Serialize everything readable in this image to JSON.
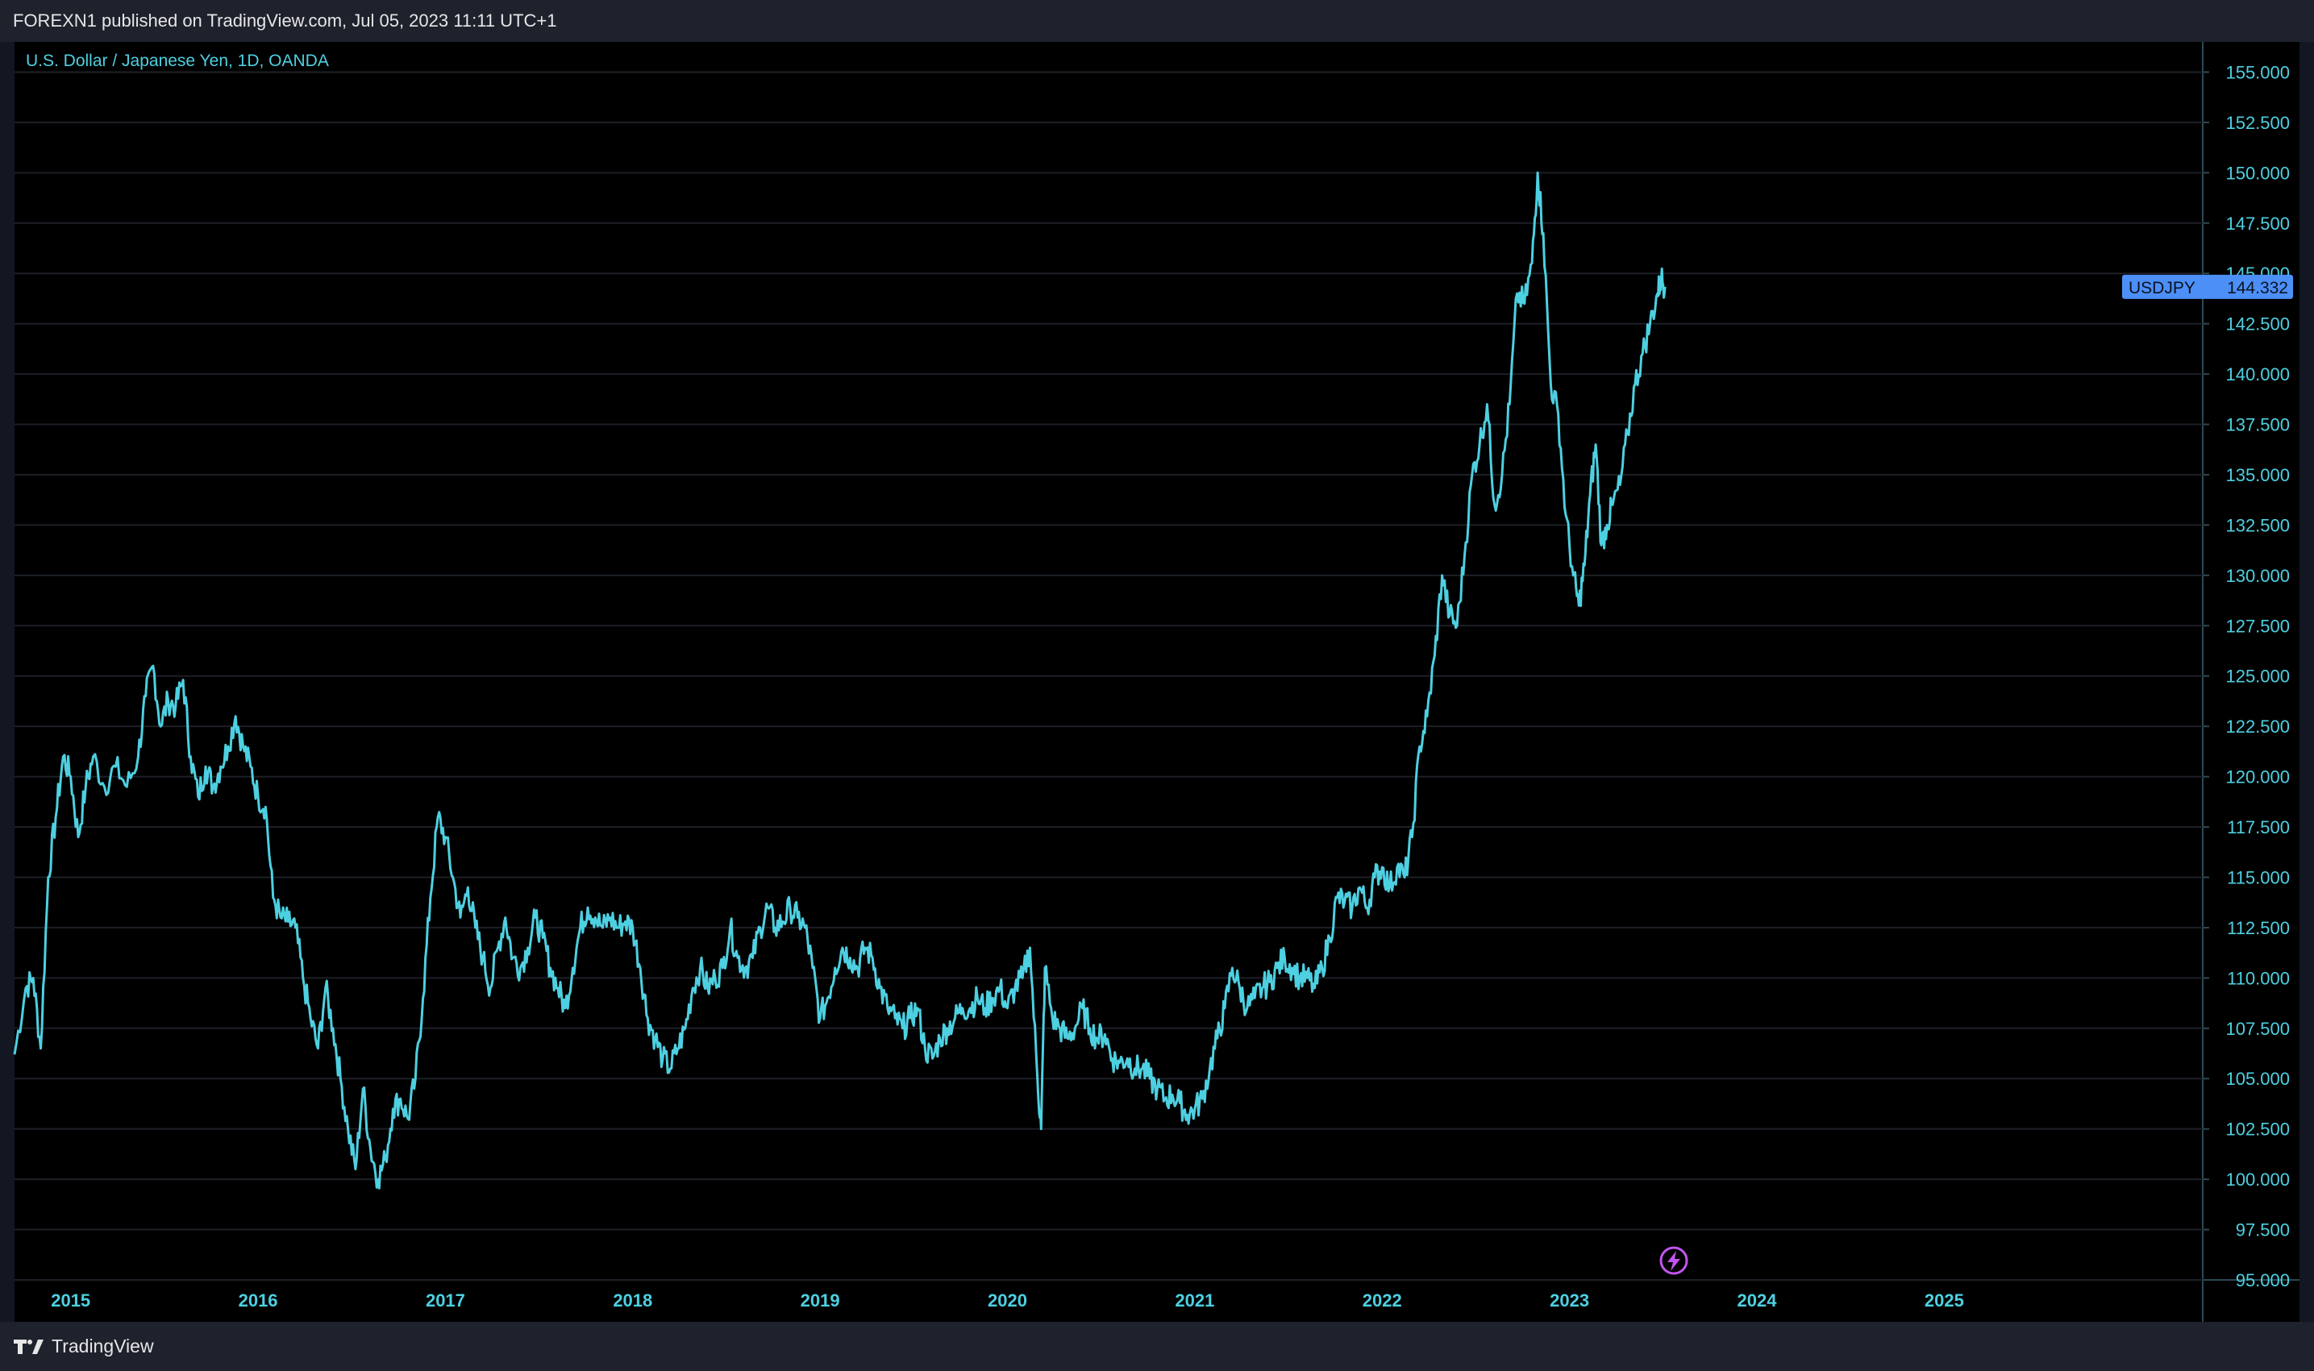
{
  "header": {
    "text": "FOREXN1 published on TradingView.com, Jul 05, 2023 11:11 UTC+1"
  },
  "legend": {
    "text": "U.S. Dollar / Japanese Yen, 1D, OANDA"
  },
  "footer": {
    "brand": "TradingView",
    "logo_icon": "tradingview-logo-icon"
  },
  "price_tag": {
    "symbol": "USDJPY",
    "value": "144.332",
    "color": "#4c8ff7"
  },
  "colors": {
    "line": "#4dd0e1",
    "grid": "#1c1f26",
    "axis_text": "#4dd0e1",
    "background": "#000000"
  },
  "bolt_icon": "lightning-icon",
  "chart_data": {
    "type": "line",
    "title": "U.S. Dollar / Japanese Yen, 1D, OANDA",
    "series": [
      {
        "name": "USDJPY",
        "color": "#4dd0e1"
      }
    ],
    "yticks": [
      "95.000",
      "97.500",
      "100.000",
      "102.500",
      "105.000",
      "107.500",
      "110.000",
      "112.500",
      "115.000",
      "117.500",
      "120.000",
      "122.500",
      "125.000",
      "127.500",
      "130.000",
      "132.500",
      "135.000",
      "137.500",
      "140.000",
      "142.500",
      "145.000",
      "147.500",
      "150.000",
      "152.500",
      "155.000"
    ],
    "xticks": [
      "2015",
      "2016",
      "2017",
      "2018",
      "2019",
      "2020",
      "2021",
      "2022",
      "2023",
      "2024",
      "2025"
    ],
    "ylim": [
      95,
      156.5
    ],
    "xlim": [
      2014.7,
      2026.38
    ],
    "last_value": 144.332,
    "points": [
      [
        2014.7,
        106.2
      ],
      [
        2014.76,
        109.5
      ],
      [
        2014.8,
        110.0
      ],
      [
        2014.84,
        106.5
      ],
      [
        2014.88,
        115.0
      ],
      [
        2014.92,
        118.0
      ],
      [
        2014.96,
        121.0
      ],
      [
        2015.0,
        120.0
      ],
      [
        2015.04,
        117.0
      ],
      [
        2015.08,
        119.5
      ],
      [
        2015.12,
        121.0
      ],
      [
        2015.18,
        119.5
      ],
      [
        2015.24,
        120.5
      ],
      [
        2015.3,
        119.5
      ],
      [
        2015.36,
        121.0
      ],
      [
        2015.4,
        124.0
      ],
      [
        2015.44,
        125.5
      ],
      [
        2015.48,
        122.5
      ],
      [
        2015.52,
        123.8
      ],
      [
        2015.56,
        123.5
      ],
      [
        2015.6,
        124.8
      ],
      [
        2015.64,
        121.0
      ],
      [
        2015.68,
        119.0
      ],
      [
        2015.72,
        120.5
      ],
      [
        2015.76,
        119.5
      ],
      [
        2015.8,
        120.5
      ],
      [
        2015.84,
        121.5
      ],
      [
        2015.88,
        123.0
      ],
      [
        2015.92,
        121.5
      ],
      [
        2015.96,
        120.5
      ],
      [
        2016.0,
        119.0
      ],
      [
        2016.04,
        118.5
      ],
      [
        2016.08,
        114.0
      ],
      [
        2016.12,
        113.0
      ],
      [
        2016.16,
        112.8
      ],
      [
        2016.2,
        112.5
      ],
      [
        2016.24,
        110.0
      ],
      [
        2016.28,
        108.0
      ],
      [
        2016.32,
        106.5
      ],
      [
        2016.36,
        109.5
      ],
      [
        2016.4,
        107.5
      ],
      [
        2016.44,
        105.0
      ],
      [
        2016.48,
        102.5
      ],
      [
        2016.52,
        100.5
      ],
      [
        2016.56,
        104.5
      ],
      [
        2016.6,
        101.5
      ],
      [
        2016.64,
        100.0
      ],
      [
        2016.68,
        101.0
      ],
      [
        2016.72,
        103.5
      ],
      [
        2016.76,
        104.0
      ],
      [
        2016.8,
        103.0
      ],
      [
        2016.84,
        105.0
      ],
      [
        2016.88,
        109.0
      ],
      [
        2016.92,
        114.0
      ],
      [
        2016.96,
        118.0
      ],
      [
        2017.0,
        117.0
      ],
      [
        2017.04,
        115.0
      ],
      [
        2017.08,
        113.0
      ],
      [
        2017.12,
        114.5
      ],
      [
        2017.16,
        112.5
      ],
      [
        2017.2,
        111.0
      ],
      [
        2017.24,
        109.5
      ],
      [
        2017.28,
        111.5
      ],
      [
        2017.32,
        113.0
      ],
      [
        2017.36,
        111.0
      ],
      [
        2017.4,
        110.5
      ],
      [
        2017.44,
        111.5
      ],
      [
        2017.48,
        113.0
      ],
      [
        2017.52,
        112.0
      ],
      [
        2017.56,
        110.5
      ],
      [
        2017.6,
        109.5
      ],
      [
        2017.64,
        108.5
      ],
      [
        2017.68,
        110.5
      ],
      [
        2017.72,
        112.5
      ],
      [
        2017.76,
        113.5
      ],
      [
        2017.8,
        113.0
      ],
      [
        2017.84,
        112.5
      ],
      [
        2017.88,
        113.0
      ],
      [
        2017.92,
        112.5
      ],
      [
        2017.96,
        112.8
      ],
      [
        2018.0,
        112.5
      ],
      [
        2018.04,
        110.5
      ],
      [
        2018.08,
        108.0
      ],
      [
        2018.12,
        107.0
      ],
      [
        2018.16,
        106.0
      ],
      [
        2018.2,
        105.5
      ],
      [
        2018.24,
        106.5
      ],
      [
        2018.28,
        107.5
      ],
      [
        2018.32,
        109.5
      ],
      [
        2018.36,
        110.5
      ],
      [
        2018.4,
        109.5
      ],
      [
        2018.44,
        110.0
      ],
      [
        2018.48,
        110.5
      ],
      [
        2018.52,
        112.5
      ],
      [
        2018.56,
        111.0
      ],
      [
        2018.6,
        110.5
      ],
      [
        2018.64,
        111.0
      ],
      [
        2018.68,
        112.5
      ],
      [
        2018.72,
        113.5
      ],
      [
        2018.76,
        112.5
      ],
      [
        2018.8,
        112.8
      ],
      [
        2018.84,
        113.5
      ],
      [
        2018.88,
        113.0
      ],
      [
        2018.92,
        112.5
      ],
      [
        2018.96,
        110.5
      ],
      [
        2019.0,
        108.0
      ],
      [
        2019.04,
        109.0
      ],
      [
        2019.08,
        110.5
      ],
      [
        2019.12,
        111.5
      ],
      [
        2019.16,
        111.0
      ],
      [
        2019.2,
        110.5
      ],
      [
        2019.24,
        111.5
      ],
      [
        2019.28,
        111.0
      ],
      [
        2019.32,
        109.5
      ],
      [
        2019.36,
        108.5
      ],
      [
        2019.4,
        108.0
      ],
      [
        2019.44,
        107.5
      ],
      [
        2019.48,
        108.0
      ],
      [
        2019.52,
        108.5
      ],
      [
        2019.56,
        106.5
      ],
      [
        2019.6,
        106.0
      ],
      [
        2019.64,
        107.0
      ],
      [
        2019.68,
        107.5
      ],
      [
        2019.72,
        108.0
      ],
      [
        2019.76,
        108.5
      ],
      [
        2019.8,
        108.5
      ],
      [
        2019.84,
        109.0
      ],
      [
        2019.88,
        108.5
      ],
      [
        2019.92,
        109.0
      ],
      [
        2019.96,
        109.5
      ],
      [
        2020.0,
        108.5
      ],
      [
        2020.04,
        109.5
      ],
      [
        2020.08,
        110.0
      ],
      [
        2020.12,
        111.5
      ],
      [
        2020.16,
        105.0
      ],
      [
        2020.18,
        102.5
      ],
      [
        2020.2,
        110.5
      ],
      [
        2020.24,
        108.0
      ],
      [
        2020.28,
        107.5
      ],
      [
        2020.32,
        107.0
      ],
      [
        2020.36,
        107.5
      ],
      [
        2020.4,
        108.5
      ],
      [
        2020.44,
        107.5
      ],
      [
        2020.48,
        107.0
      ],
      [
        2020.52,
        107.2
      ],
      [
        2020.56,
        106.0
      ],
      [
        2020.6,
        105.8
      ],
      [
        2020.64,
        106.0
      ],
      [
        2020.68,
        105.5
      ],
      [
        2020.72,
        105.5
      ],
      [
        2020.76,
        105.0
      ],
      [
        2020.8,
        104.5
      ],
      [
        2020.84,
        104.0
      ],
      [
        2020.88,
        104.2
      ],
      [
        2020.92,
        103.8
      ],
      [
        2020.96,
        103.2
      ],
      [
        2021.0,
        103.5
      ],
      [
        2021.04,
        104.0
      ],
      [
        2021.08,
        105.5
      ],
      [
        2021.12,
        107.0
      ],
      [
        2021.16,
        108.5
      ],
      [
        2021.2,
        110.5
      ],
      [
        2021.24,
        109.5
      ],
      [
        2021.28,
        108.5
      ],
      [
        2021.32,
        109.0
      ],
      [
        2021.36,
        109.5
      ],
      [
        2021.4,
        109.8
      ],
      [
        2021.44,
        110.5
      ],
      [
        2021.48,
        111.0
      ],
      [
        2021.52,
        110.5
      ],
      [
        2021.56,
        110.0
      ],
      [
        2021.6,
        110.0
      ],
      [
        2021.64,
        109.5
      ],
      [
        2021.68,
        110.5
      ],
      [
        2021.72,
        112.0
      ],
      [
        2021.76,
        114.0
      ],
      [
        2021.8,
        113.8
      ],
      [
        2021.84,
        113.5
      ],
      [
        2021.88,
        114.5
      ],
      [
        2021.92,
        113.5
      ],
      [
        2021.96,
        115.0
      ],
      [
        2022.0,
        115.5
      ],
      [
        2022.04,
        114.5
      ],
      [
        2022.08,
        115.5
      ],
      [
        2022.12,
        115.0
      ],
      [
        2022.16,
        117.0
      ],
      [
        2022.2,
        121.5
      ],
      [
        2022.24,
        123.0
      ],
      [
        2022.28,
        126.0
      ],
      [
        2022.32,
        130.0
      ],
      [
        2022.36,
        128.0
      ],
      [
        2022.4,
        127.5
      ],
      [
        2022.44,
        131.0
      ],
      [
        2022.48,
        135.0
      ],
      [
        2022.52,
        136.5
      ],
      [
        2022.56,
        138.5
      ],
      [
        2022.6,
        133.5
      ],
      [
        2022.64,
        135.0
      ],
      [
        2022.68,
        138.5
      ],
      [
        2022.72,
        144.0
      ],
      [
        2022.76,
        143.5
      ],
      [
        2022.8,
        145.5
      ],
      [
        2022.83,
        150.0
      ],
      [
        2022.86,
        147.0
      ],
      [
        2022.9,
        139.5
      ],
      [
        2022.94,
        138.0
      ],
      [
        2022.98,
        133.0
      ],
      [
        2023.02,
        130.0
      ],
      [
        2023.05,
        128.5
      ],
      [
        2023.08,
        130.5
      ],
      [
        2023.11,
        134.0
      ],
      [
        2023.14,
        136.5
      ],
      [
        2023.17,
        131.5
      ],
      [
        2023.2,
        132.5
      ],
      [
        2023.23,
        133.5
      ],
      [
        2023.27,
        134.5
      ],
      [
        2023.31,
        137.0
      ],
      [
        2023.35,
        139.5
      ],
      [
        2023.39,
        141.0
      ],
      [
        2023.43,
        142.5
      ],
      [
        2023.47,
        144.0
      ],
      [
        2023.49,
        144.8
      ],
      [
        2023.51,
        144.332
      ]
    ]
  }
}
